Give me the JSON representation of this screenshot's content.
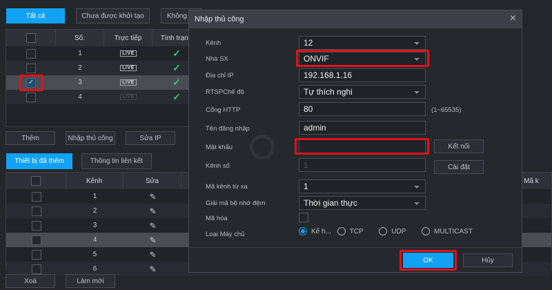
{
  "top_tabs": [
    "Tất cả",
    "Chưa được khởi tạo",
    "Không"
  ],
  "device_table": {
    "headers": [
      "Số.",
      "Trực tiếp",
      "Tình trạng"
    ],
    "rows": [
      {
        "no": "1",
        "live": "LIVE",
        "checked": false
      },
      {
        "no": "2",
        "live": "LIVE",
        "checked": false
      },
      {
        "no": "3",
        "live": "LIVE",
        "checked": true
      },
      {
        "no": "4",
        "live": "LIVE",
        "checked": false
      }
    ]
  },
  "device_buttons": {
    "add": "Thêm",
    "manual": "Nhập thủ công",
    "edit_ip": "Sửa IP"
  },
  "bottom_tabs": [
    "Thiết bị đã thêm",
    "Thông tin liên kết"
  ],
  "added_table": {
    "headers": [
      "Kênh",
      "Sửa",
      "Mã k"
    ],
    "rows": [
      "1",
      "2",
      "3",
      "4",
      "5",
      "6"
    ]
  },
  "bottom_buttons": {
    "delete": "Xoá",
    "refresh": "Làm mới"
  },
  "dialog": {
    "title": "Nhập thủ công",
    "close": "×",
    "fields": {
      "channel": {
        "label": "Kênh",
        "value": "12"
      },
      "manufacturer": {
        "label": "Nhà SX",
        "value": "ONVIF"
      },
      "ip": {
        "label": "Địa chỉ IP",
        "value": "192.168.1.16"
      },
      "rtsp": {
        "label": "RTSPChế độ",
        "value": "Tự thích nghi"
      },
      "http_port": {
        "label": "Cổng HTTP",
        "value": "80",
        "hint": "(1~65535)"
      },
      "username": {
        "label": "Tên đăng nhập",
        "value": "admin"
      },
      "password": {
        "label": "Mật khẩu",
        "value": ""
      },
      "channel_no": {
        "label": "Kênh số",
        "value": "1"
      },
      "remote_channel": {
        "label": "Mã kênh từ xa",
        "value": "1"
      },
      "buffer": {
        "label": "Giải mã bộ nhớ đệm",
        "value": "Thời gian thực"
      },
      "encrypt": {
        "label": "Mã hóa",
        "checked": false
      },
      "server_type": {
        "label": "Loại Máy chủ",
        "options": [
          "Kế h...",
          "TCP",
          "UDP",
          "MULTICAST"
        ],
        "selected": "Kế h..."
      }
    },
    "connect": "Kết nối",
    "settings": "Cài đặt",
    "ok": "OK",
    "cancel": "Hủy"
  },
  "colors": {
    "accent": "#11a2f3",
    "highlight": "#e0121b",
    "ok_check": "#2ecc71"
  }
}
